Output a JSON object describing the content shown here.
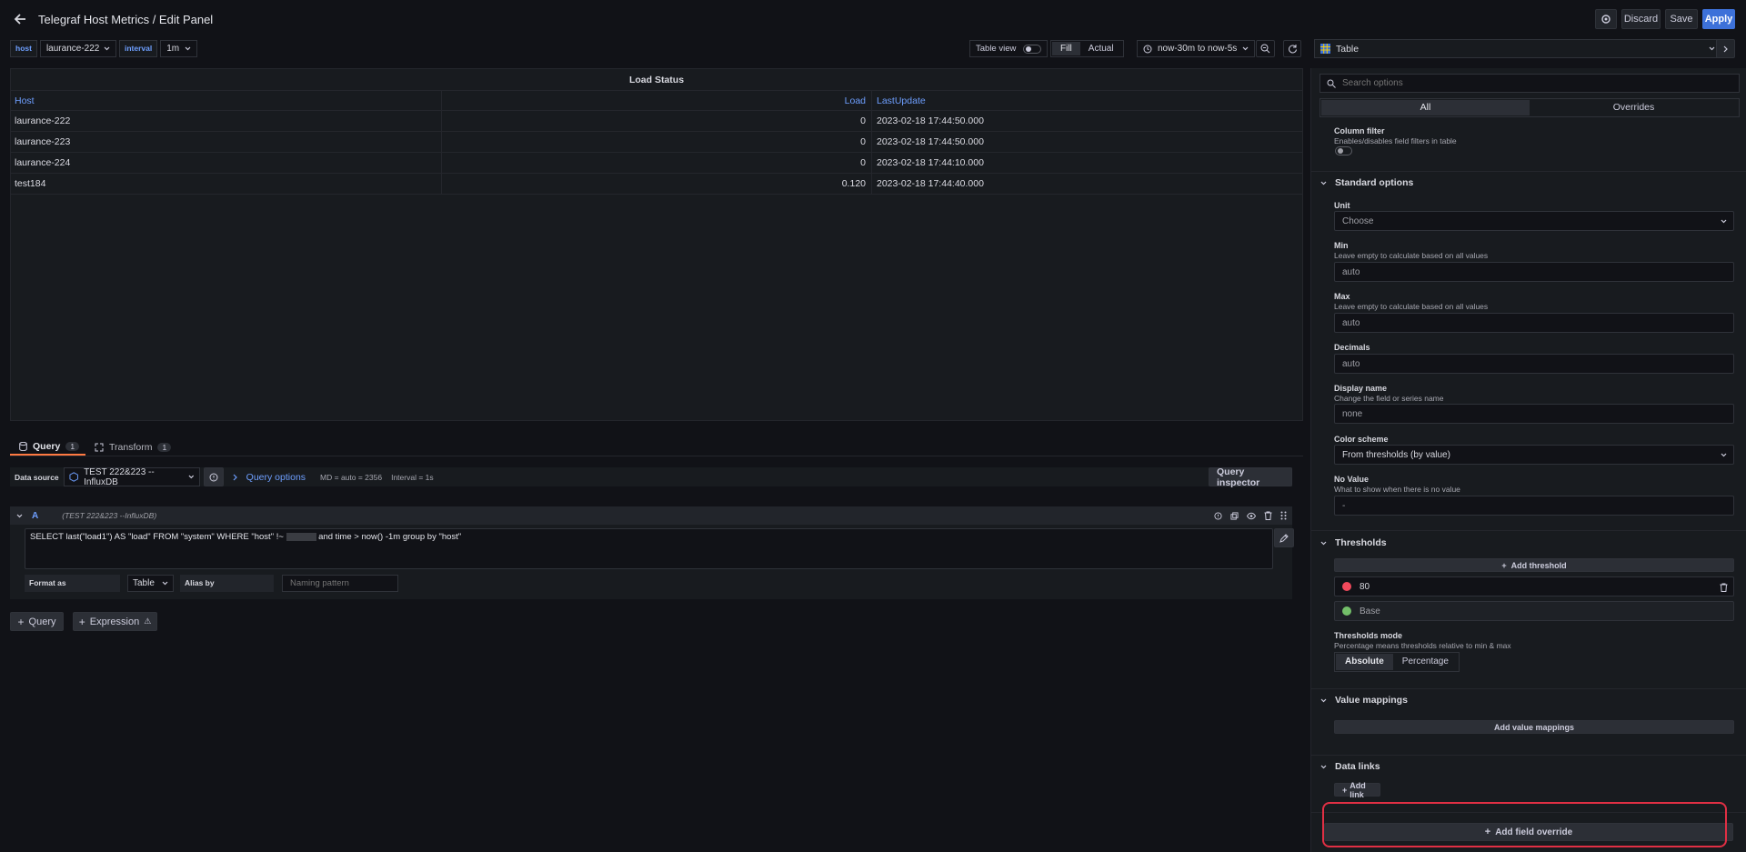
{
  "header": {
    "title": "Telegraf Host Metrics / Edit Panel",
    "discard": "Discard",
    "save": "Save",
    "apply": "Apply"
  },
  "variables": [
    {
      "label": "host",
      "value": "laurance-222"
    },
    {
      "label": "interval",
      "value": "1m"
    }
  ],
  "toolbar": {
    "table_view": "Table view",
    "fill": "Fill",
    "actual": "Actual",
    "time_range": "now-30m to now-5s"
  },
  "panel": {
    "title": "Load Status",
    "columns": [
      "Host",
      "Load",
      "LastUpdate"
    ],
    "rows": [
      [
        "laurance-222",
        "0",
        "2023-02-18 17:44:50.000"
      ],
      [
        "laurance-223",
        "0",
        "2023-02-18 17:44:50.000"
      ],
      [
        "laurance-224",
        "0",
        "2023-02-18 17:44:10.000"
      ],
      [
        "test184",
        "0.120",
        "2023-02-18 17:44:40.000"
      ]
    ]
  },
  "query_tabs": {
    "query": "Query",
    "query_count": "1",
    "transform": "Transform",
    "transform_count": "1"
  },
  "datasource": {
    "label": "Data source",
    "name": "TEST 222&223 --InfluxDB",
    "query_options": "Query options",
    "md": "MD = auto = 2356",
    "interval": "Interval = 1s",
    "inspector": "Query inspector"
  },
  "query": {
    "ref": "A",
    "source": "(TEST 222&223 --InfluxDB)",
    "text_before": "SELECT last(\"load1\") AS \"load\" FROM \"system\" WHERE  \"host\" !~ ",
    "text_after": " and time > now() -1m group by \"host\"",
    "format_label": "Format as",
    "format_value": "Table",
    "alias_label": "Alias by",
    "alias_placeholder": "Naming pattern",
    "add_query": "Query",
    "add_expression": "Expression"
  },
  "viz": {
    "name": "Table"
  },
  "options": {
    "search_placeholder": "Search options",
    "tab_all": "All",
    "tab_overrides": "Overrides",
    "column_filter_label": "Column filter",
    "column_filter_desc": "Enables/disables field filters in table",
    "standard_title": "Standard options",
    "unit_label": "Unit",
    "unit_value": "Choose",
    "min_label": "Min",
    "min_desc": "Leave empty to calculate based on all values",
    "min_placeholder": "auto",
    "max_label": "Max",
    "max_desc": "Leave empty to calculate based on all values",
    "max_placeholder": "auto",
    "decimals_label": "Decimals",
    "decimals_placeholder": "auto",
    "display_name_label": "Display name",
    "display_name_desc": "Change the field or series name",
    "display_name_placeholder": "none",
    "color_scheme_label": "Color scheme",
    "color_scheme_value": "From thresholds (by value)",
    "novalue_label": "No Value",
    "novalue_desc": "What to show when there is no value",
    "novalue_placeholder": "-",
    "thresholds_title": "Thresholds",
    "add_threshold": "Add threshold",
    "threshold_value": "80",
    "threshold_base": "Base",
    "thresholds_mode_label": "Thresholds mode",
    "thresholds_mode_desc": "Percentage means thresholds relative to min & max",
    "mode_absolute": "Absolute",
    "mode_percentage": "Percentage",
    "value_mappings_title": "Value mappings",
    "add_value_mappings": "Add value mappings",
    "data_links_title": "Data links",
    "add_link": "Add link",
    "add_field_override": "Add field override"
  },
  "colors": {
    "accent": "#6e9fff",
    "apply": "#3d71d9",
    "tab_underline": "#ff7941",
    "threshold_red": "#f2495c",
    "threshold_green": "#73bf69",
    "highlight": "#e02f44"
  }
}
